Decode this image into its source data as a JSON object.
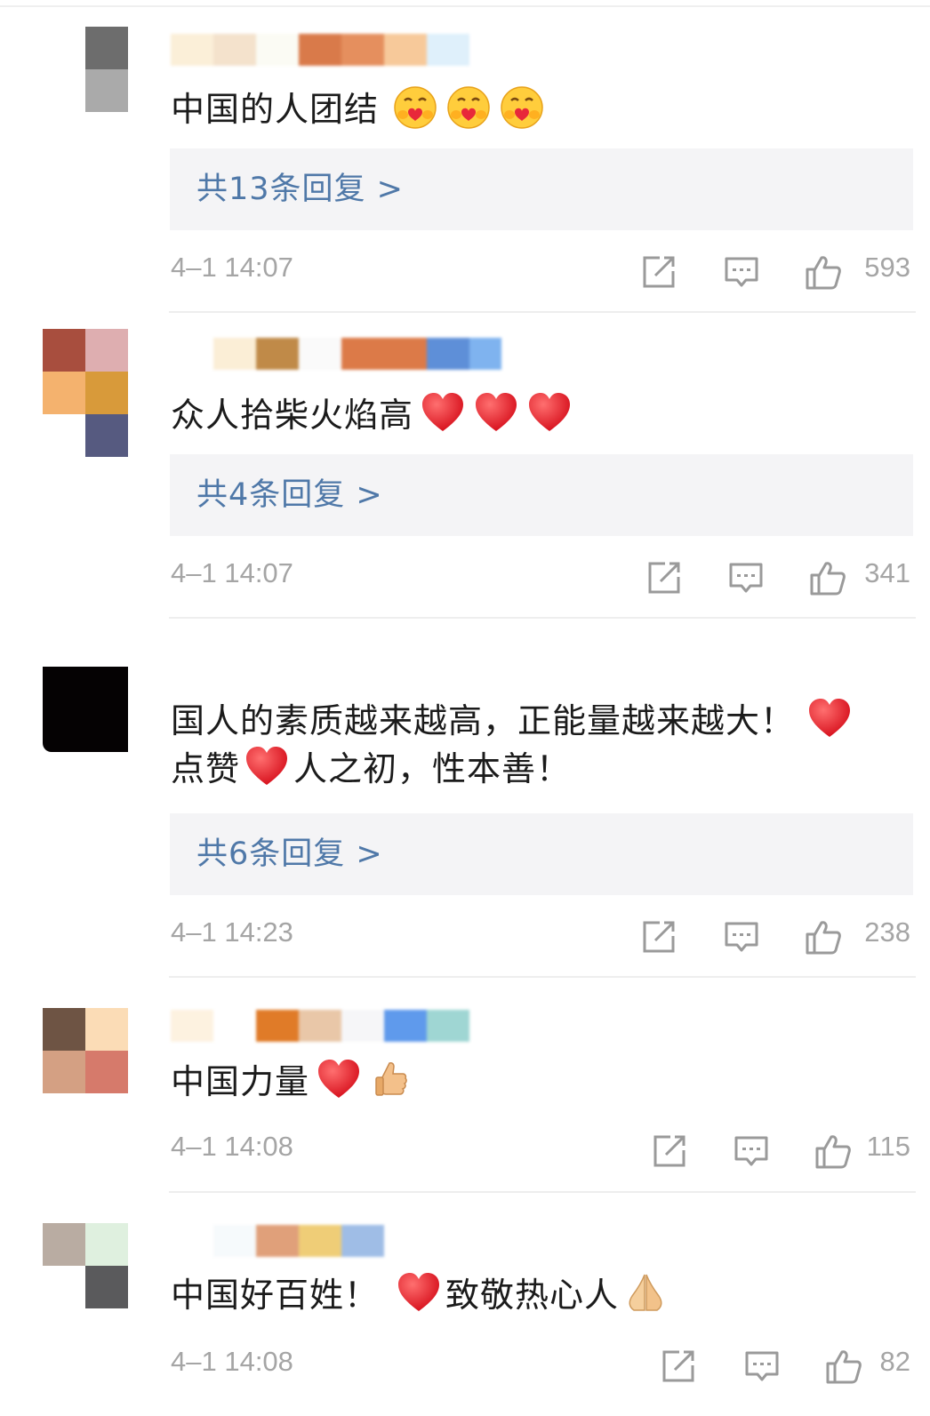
{
  "comments": [
    {
      "text": "中国的人团结",
      "reply_label": "共13条回复 >",
      "time": "4–1 14:07",
      "likes": "593",
      "emojis": [
        "hugging-face",
        "hugging-face",
        "hugging-face"
      ]
    },
    {
      "text": "众人拾柴火焰高",
      "reply_label": "共4条回复 >",
      "time": "4–1 14:07",
      "likes": "341",
      "emojis": [
        "red-heart",
        "red-heart",
        "red-heart"
      ]
    },
    {
      "text_line1": "国人的素质越来越高，正能量越来越大！",
      "text_line2a": "点赞",
      "text_line2b": "人之初，性本善！",
      "reply_label": "共6条回复 >",
      "time": "4–1 14:23",
      "likes": "238",
      "emojis": [
        "red-heart",
        "red-heart"
      ]
    },
    {
      "text": "中国力量",
      "time": "4–1 14:08",
      "likes": "115",
      "emojis": [
        "red-heart",
        "thumbs-up"
      ]
    },
    {
      "text_a": "中国好百姓！",
      "text_b": "致敬热心人",
      "time": "4–1 14:08",
      "likes": "82",
      "emojis": [
        "red-heart",
        "folded-hands"
      ]
    }
  ],
  "icons": {
    "share": "share-icon",
    "comment": "comment-icon",
    "like": "thumbs-up-icon"
  },
  "colors": {
    "reply_link": "#4f78a8",
    "meta_text": "#a5a5a5",
    "reply_bg": "#f4f4f6",
    "heart": "#e0242e"
  }
}
